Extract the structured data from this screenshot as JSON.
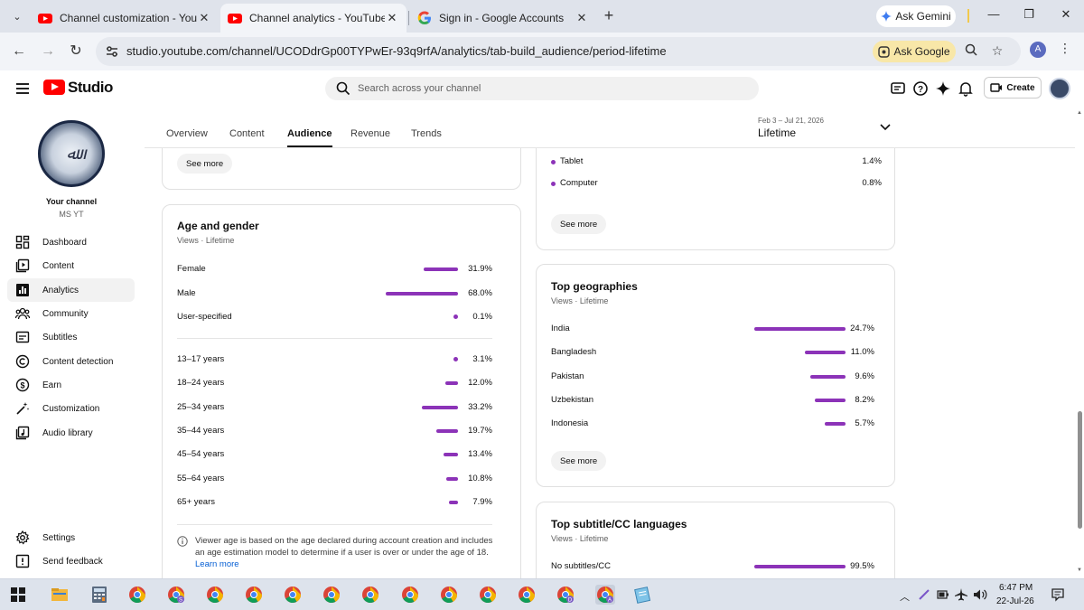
{
  "browser": {
    "tabs": [
      {
        "title": "Channel customization - YouTube Studio",
        "active": false
      },
      {
        "title": "Channel analytics - YouTube Studio",
        "active": true
      },
      {
        "title": "Sign in - Google Accounts",
        "active": false
      }
    ],
    "gemini_label": "Ask Gemini",
    "url": "studio.youtube.com/channel/UCODdrGp00TYPwEr-93q9rfA/analytics/tab-build_audience/period-lifetime",
    "ask_google_label": "Ask Google",
    "profile_initial": "A"
  },
  "studio": {
    "logo_text": "Studio",
    "search_placeholder": "Search across your channel",
    "create_label": "Create"
  },
  "sidebar": {
    "your_channel": "Your channel",
    "channel_name": "MS YT",
    "items": [
      {
        "label": "Dashboard",
        "icon": "dashboard-icon",
        "active": false
      },
      {
        "label": "Content",
        "icon": "content-icon",
        "active": false
      },
      {
        "label": "Analytics",
        "icon": "analytics-icon",
        "active": true
      },
      {
        "label": "Community",
        "icon": "community-icon",
        "active": false
      },
      {
        "label": "Subtitles",
        "icon": "subtitles-icon",
        "active": false
      },
      {
        "label": "Content detection",
        "icon": "copyright-icon",
        "active": false
      },
      {
        "label": "Earn",
        "icon": "dollar-icon",
        "active": false
      },
      {
        "label": "Customization",
        "icon": "magic-wand-icon",
        "active": false
      },
      {
        "label": "Audio library",
        "icon": "audio-library-icon",
        "active": false
      }
    ],
    "bottom_items": [
      {
        "label": "Settings",
        "icon": "gear-icon"
      },
      {
        "label": "Send feedback",
        "icon": "feedback-icon"
      }
    ]
  },
  "analytics_tabs": [
    {
      "label": "Overview",
      "active": false
    },
    {
      "label": "Content",
      "active": false
    },
    {
      "label": "Audience",
      "active": true
    },
    {
      "label": "Revenue",
      "active": false
    },
    {
      "label": "Trends",
      "active": false
    }
  ],
  "period": {
    "range": "Feb 3 – Jul 21, 2026",
    "value": "Lifetime"
  },
  "see_more_label": "See more",
  "devices_card": {
    "rows": [
      {
        "label": "Tablet",
        "pct": "1.4%"
      },
      {
        "label": "Computer",
        "pct": "0.8%"
      }
    ]
  },
  "age_gender": {
    "title": "Age and gender",
    "subtitle": "Views · Lifetime",
    "gender": [
      {
        "label": "Female",
        "pct": "31.9%",
        "value": 31.9
      },
      {
        "label": "Male",
        "pct": "68.0%",
        "value": 68.0
      },
      {
        "label": "User-specified",
        "pct": "0.1%",
        "value": 0.1
      }
    ],
    "ages": [
      {
        "label": "13–17 years",
        "pct": "3.1%",
        "value": 3.1
      },
      {
        "label": "18–24 years",
        "pct": "12.0%",
        "value": 12.0
      },
      {
        "label": "25–34 years",
        "pct": "33.2%",
        "value": 33.2
      },
      {
        "label": "35–44 years",
        "pct": "19.7%",
        "value": 19.7
      },
      {
        "label": "45–54 years",
        "pct": "13.4%",
        "value": 13.4
      },
      {
        "label": "55–64 years",
        "pct": "10.8%",
        "value": 10.8
      },
      {
        "label": "65+ years",
        "pct": "7.9%",
        "value": 7.9
      }
    ],
    "note": "Viewer age is based on the age declared during account creation and includes an age estimation model to determine if a user is over or under the age of 18.",
    "learn_more": "Learn more"
  },
  "geographies": {
    "title": "Top geographies",
    "subtitle": "Views · Lifetime",
    "rows": [
      {
        "label": "India",
        "pct": "24.7%",
        "value": 24.7
      },
      {
        "label": "Bangladesh",
        "pct": "11.0%",
        "value": 11.0
      },
      {
        "label": "Pakistan",
        "pct": "9.6%",
        "value": 9.6
      },
      {
        "label": "Uzbekistan",
        "pct": "8.2%",
        "value": 8.2
      },
      {
        "label": "Indonesia",
        "pct": "5.7%",
        "value": 5.7
      }
    ]
  },
  "subtitles": {
    "title": "Top subtitle/CC languages",
    "subtitle": "Views · Lifetime",
    "rows": [
      {
        "label": "No subtitles/CC",
        "pct": "99.5%",
        "value": 99.5
      }
    ]
  },
  "taskbar": {
    "time": "6:47 PM",
    "date": "22-Jul-26"
  },
  "colors": {
    "bar": "#8c33b8",
    "youtube_red": "#ff0000",
    "link": "#065fd4"
  }
}
